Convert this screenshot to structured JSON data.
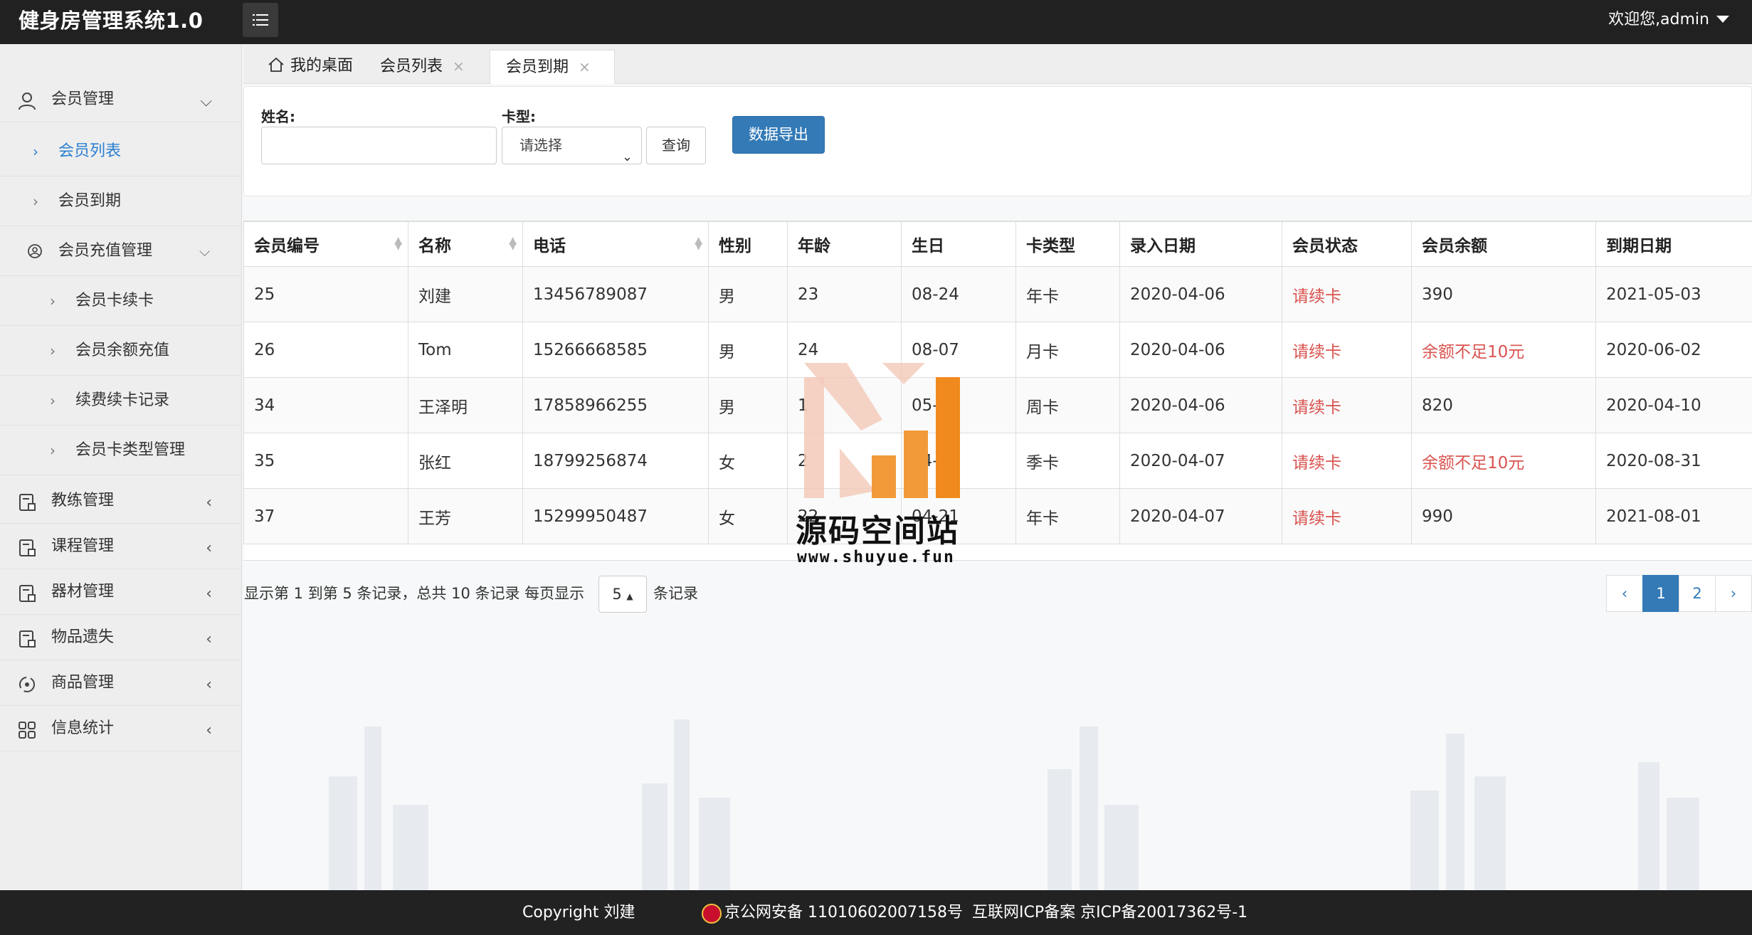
{
  "app": {
    "title": "健身房管理系统1.0",
    "welcome": "欢迎您,admin"
  },
  "sidebar": {
    "items": [
      {
        "label": "会员管理",
        "icon": "user-icon"
      },
      {
        "label": "会员列表"
      },
      {
        "label": "会员到期"
      },
      {
        "label": "会员充值管理",
        "icon": "user-circle-icon"
      },
      {
        "label": "会员卡续卡"
      },
      {
        "label": "会员余额充值"
      },
      {
        "label": "续费续卡记录"
      },
      {
        "label": "会员卡类型管理"
      },
      {
        "label": "教练管理",
        "icon": "document-icon"
      },
      {
        "label": "课程管理",
        "icon": "document-icon"
      },
      {
        "label": "器材管理",
        "icon": "document-icon"
      },
      {
        "label": "物品遗失",
        "icon": "document-icon"
      },
      {
        "label": "商品管理",
        "icon": "goods-icon"
      },
      {
        "label": "信息统计",
        "icon": "grid-icon"
      }
    ]
  },
  "tabs": [
    {
      "label": "我的桌面"
    },
    {
      "label": "会员列表"
    },
    {
      "label": "会员到期"
    }
  ],
  "search": {
    "name_label": "姓名:",
    "name_value": "",
    "card_label": "卡型:",
    "card_selected": "请选择",
    "query_label": "查询",
    "export_label": "数据导出"
  },
  "table": {
    "headers": [
      "会员编号",
      "名称",
      "电话",
      "性别",
      "年龄",
      "生日",
      "卡类型",
      "录入日期",
      "会员状态",
      "会员余额",
      "到期日期"
    ],
    "rows": [
      [
        "25",
        "刘建",
        "13456789087",
        "男",
        "23",
        "08-24",
        "年卡",
        "2020-04-06",
        "请续卡",
        "390",
        "2021-05-03"
      ],
      [
        "26",
        "Tom",
        "15266668585",
        "男",
        "24",
        "08-07",
        "月卡",
        "2020-04-06",
        "请续卡",
        "余额不足10元",
        "2020-06-02"
      ],
      [
        "34",
        "王泽明",
        "17858966255",
        "男",
        "1",
        "05-18",
        "周卡",
        "2020-04-06",
        "请续卡",
        "820",
        "2020-04-10"
      ],
      [
        "35",
        "张红",
        "18799256874",
        "女",
        "2",
        "04-18",
        "季卡",
        "2020-04-07",
        "请续卡",
        "余额不足10元",
        "2020-08-31"
      ],
      [
        "37",
        "王芳",
        "15299950487",
        "女",
        "22",
        "04-21",
        "年卡",
        "2020-04-07",
        "请续卡",
        "990",
        "2021-08-01"
      ]
    ],
    "red_color": "#d9534f"
  },
  "pagination": {
    "info": "显示第 1 到第 5 条记录，总共 10 条记录 每页显示",
    "page_size": "5",
    "suffix": "条记录",
    "prev": "‹",
    "pages": [
      "1",
      "2"
    ],
    "next": "›",
    "current": "1"
  },
  "watermark": {
    "title": "源码空间站",
    "url": "www.shuyue.fun"
  },
  "footer": {
    "copyright": "Copyright 刘建",
    "police": "京公网安备 11010602007158号",
    "icp": "互联网ICP备案 京ICP备20017362号-1"
  },
  "colors": {
    "header_bg": "#212121",
    "accent": "#337ab7",
    "active_nav": "#2b7fd1"
  }
}
